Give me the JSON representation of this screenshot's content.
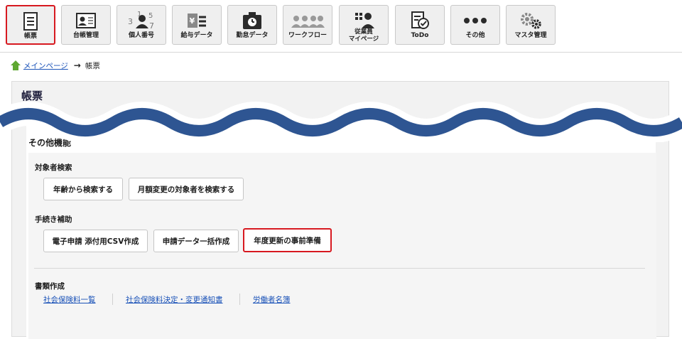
{
  "nav": [
    {
      "label": "帳票",
      "icon": "report-list-icon",
      "active": true
    },
    {
      "label": "台帳管理",
      "icon": "ledger-card-icon"
    },
    {
      "label": "個人番号",
      "icon": "personal-number-icon"
    },
    {
      "label": "給与データ",
      "icon": "salary-data-icon"
    },
    {
      "label": "勤怠データ",
      "icon": "attendance-clock-icon"
    },
    {
      "label": "ワークフロー",
      "icon": "workflow-people-icon"
    },
    {
      "label": "従業員\nマイページ",
      "icon": "employee-mypage-icon"
    },
    {
      "label": "ToDo",
      "icon": "todo-check-icon"
    },
    {
      "label": "その他",
      "icon": "more-dots-icon"
    },
    {
      "label": "マスタ管理",
      "icon": "gears-icon"
    }
  ],
  "breadcrumb": {
    "home": "メインページ",
    "current": "帳票"
  },
  "page_title": "帳票",
  "other_functions": {
    "title": "その他機能",
    "target_search": {
      "title": "対象者検索",
      "buttons": [
        "年齢から検索する",
        "月額変更の対象者を検索する"
      ]
    },
    "procedure_support": {
      "title": "手続き補助",
      "buttons": [
        "電子申請 添付用CSV作成",
        "申請データ一括作成",
        "年度更新の事前準備"
      ]
    },
    "documents": {
      "title": "書類作成",
      "links": [
        "社会保険料一覧",
        "社会保険料決定・変更通知書",
        "労働者名簿"
      ]
    }
  },
  "colors": {
    "accent_red": "#d71920",
    "wave_blue": "#2e5592",
    "link_blue": "#1a52b8"
  }
}
